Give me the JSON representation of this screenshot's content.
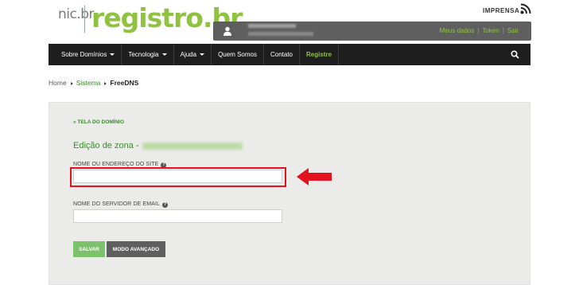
{
  "header": {
    "logo_nic": "nic.br",
    "logo_registro": "registro.br",
    "imprensa": "IMPRENSA",
    "rss_icon": "rss-icon"
  },
  "userbar": {
    "user_icon": "user-icon",
    "links": [
      "Meus dados",
      "Token",
      "Sair"
    ]
  },
  "nav": {
    "items": [
      {
        "label": "Sobre Domínios",
        "dropdown": true
      },
      {
        "label": "Tecnologia",
        "dropdown": true
      },
      {
        "label": "Ajuda",
        "dropdown": true
      },
      {
        "label": "Quem Somos",
        "dropdown": false
      },
      {
        "label": "Contato",
        "dropdown": false
      },
      {
        "label": "Registre",
        "dropdown": false
      }
    ],
    "search_icon": "search-icon"
  },
  "breadcrumb": {
    "home": "Home",
    "sistema": "Sistema",
    "current": "FreeDNS"
  },
  "form": {
    "back_link": "« TELA DO DOMÍNIO",
    "title": "Edição de zona -",
    "site_label": "NOME OU ENDEREÇO DO SITE",
    "site_value": "",
    "email_label": "NOME DO SERVIDOR DE EMAIL",
    "email_value": "",
    "save_button": "SALVAR",
    "advanced_button": "MODO AVANÇADO"
  },
  "colors": {
    "brand_green": "#8fc33f",
    "link_green": "#3d8b2f",
    "save_green": "#7cc26a",
    "highlight_red": "#e2131e",
    "nav_bg": "#1e1e1e"
  }
}
